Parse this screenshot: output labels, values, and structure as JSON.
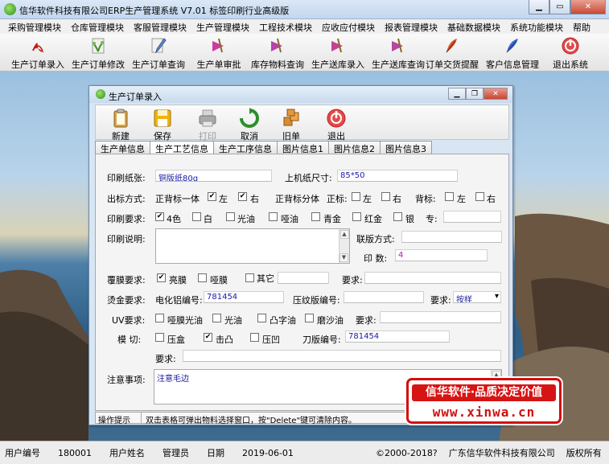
{
  "window": {
    "title": "信华软件科技有限公司ERP生产管理系统  V7.01 标签印刷行业高级版"
  },
  "menu": [
    "采购管理模块",
    "仓库管理模块",
    "客服管理模块",
    "生产管理模块",
    "工程技术模块",
    "应收应付模块",
    "报表管理模块",
    "基础数据模块",
    "系统功能模块",
    "帮助"
  ],
  "toolbar": [
    {
      "label": "生产订单录入",
      "icon": "pdf-icon"
    },
    {
      "label": "生产订单修改",
      "icon": "plant-icon"
    },
    {
      "label": "生产订单查询",
      "icon": "pencil-pen-icon"
    },
    {
      "label": "生产单审批",
      "icon": "pen-stamp-icon"
    },
    {
      "label": "库存物料查询",
      "icon": "pen-stamp-icon"
    },
    {
      "label": "生产送库录入",
      "icon": "pen-stamp-icon"
    },
    {
      "label": "生产送库查询",
      "icon": "pen-stamp-icon"
    },
    {
      "label": "订单交货提醒",
      "icon": "feather-icon"
    },
    {
      "label": "客户信息管理",
      "icon": "quill-icon"
    },
    {
      "label": "退出系统",
      "icon": "exit-icon"
    }
  ],
  "child": {
    "title": "生产订单录入",
    "toolbar": [
      {
        "label": "新建",
        "icon": "clipboard-icon",
        "enabled": true
      },
      {
        "label": "保存",
        "icon": "save-icon",
        "enabled": true
      },
      {
        "label": "打印",
        "icon": "printer-icon",
        "enabled": false
      },
      {
        "label": "取消",
        "icon": "refresh-icon",
        "enabled": true
      },
      {
        "label": "旧单",
        "icon": "boxes-icon",
        "enabled": true
      },
      {
        "label": "退出",
        "icon": "exit-icon",
        "enabled": true
      }
    ],
    "tabs": [
      "生产单信息",
      "生产工艺信息",
      "生产工序信息",
      "图片信息1",
      "图片信息2",
      "图片信息3"
    ],
    "active_tab": 1
  },
  "form": {
    "paper_label": "印刷纸张:",
    "paper_value": "铜版纸80g",
    "machine_size_label": "上机纸尺寸:",
    "machine_size_value": "85*50",
    "label_method_label": "出标方式:",
    "front_back_whole": "正背标一体",
    "left": "左",
    "right": "右",
    "front_back_split": "正背标分体",
    "front_label": "正标:",
    "back_label": "背标:",
    "left_checked": true,
    "right_checked": true,
    "print_req_label": "印刷要求:",
    "color4": "4色",
    "color4_checked": true,
    "white": "白",
    "gloss_oil": "光油",
    "matte_oil": "哑油",
    "blue_gold": "青金",
    "red_gold": "红金",
    "silver": "银",
    "special_label": "专:",
    "print_desc_label": "印刷说明:",
    "layout_method_label": "联版方式:",
    "print_qty_label": "印  数:",
    "print_qty_value": "4",
    "film_req_label": "覆膜要求:",
    "bright_film": "亮膜",
    "bright_film_checked": true,
    "matte_film": "哑膜",
    "other": "其它",
    "requirement_label": "要求:",
    "hot_stamp_label": "烫金要求:",
    "etch_no_label": "电化铝编号:",
    "etch_no_value": "781454",
    "pattern_no_label": "压纹版编号:",
    "hot_req_label": "要求:",
    "hot_req_value": "按样",
    "uv_label": "UV要求:",
    "uv_matte": "哑膜光油",
    "uv_gloss": "光油",
    "uv_raised": "凸字油",
    "uv_frosted": "磨沙油",
    "uv_req_label": "要求:",
    "die_cut_label": "模  切:",
    "press_box": "压盒",
    "emboss": "击凸",
    "deboss": "压凹",
    "emboss_checked": true,
    "knife_no_label": "刀版编号:",
    "knife_no_value": "781454",
    "die_req_label": "要求:",
    "notes_label": "注意事项:",
    "notes_value": "注意毛边"
  },
  "child_status": {
    "label": "操作提示",
    "hint": "双击表格可弹出物料选择窗口，按\"Delete\"键可清除内容。"
  },
  "brand": {
    "line1": "信华软件·品质决定价值",
    "line2": "www.xinwa.cn"
  },
  "status": {
    "user_no_label": "用户编号",
    "user_no": "180001",
    "user_name_label": "用户姓名",
    "user_name": "管理员",
    "date_label": "日期",
    "date": "2019-06-01",
    "copyright": "©2000-2018?",
    "company": "广东信华软件科技有限公司",
    "rights": "版权所有"
  }
}
